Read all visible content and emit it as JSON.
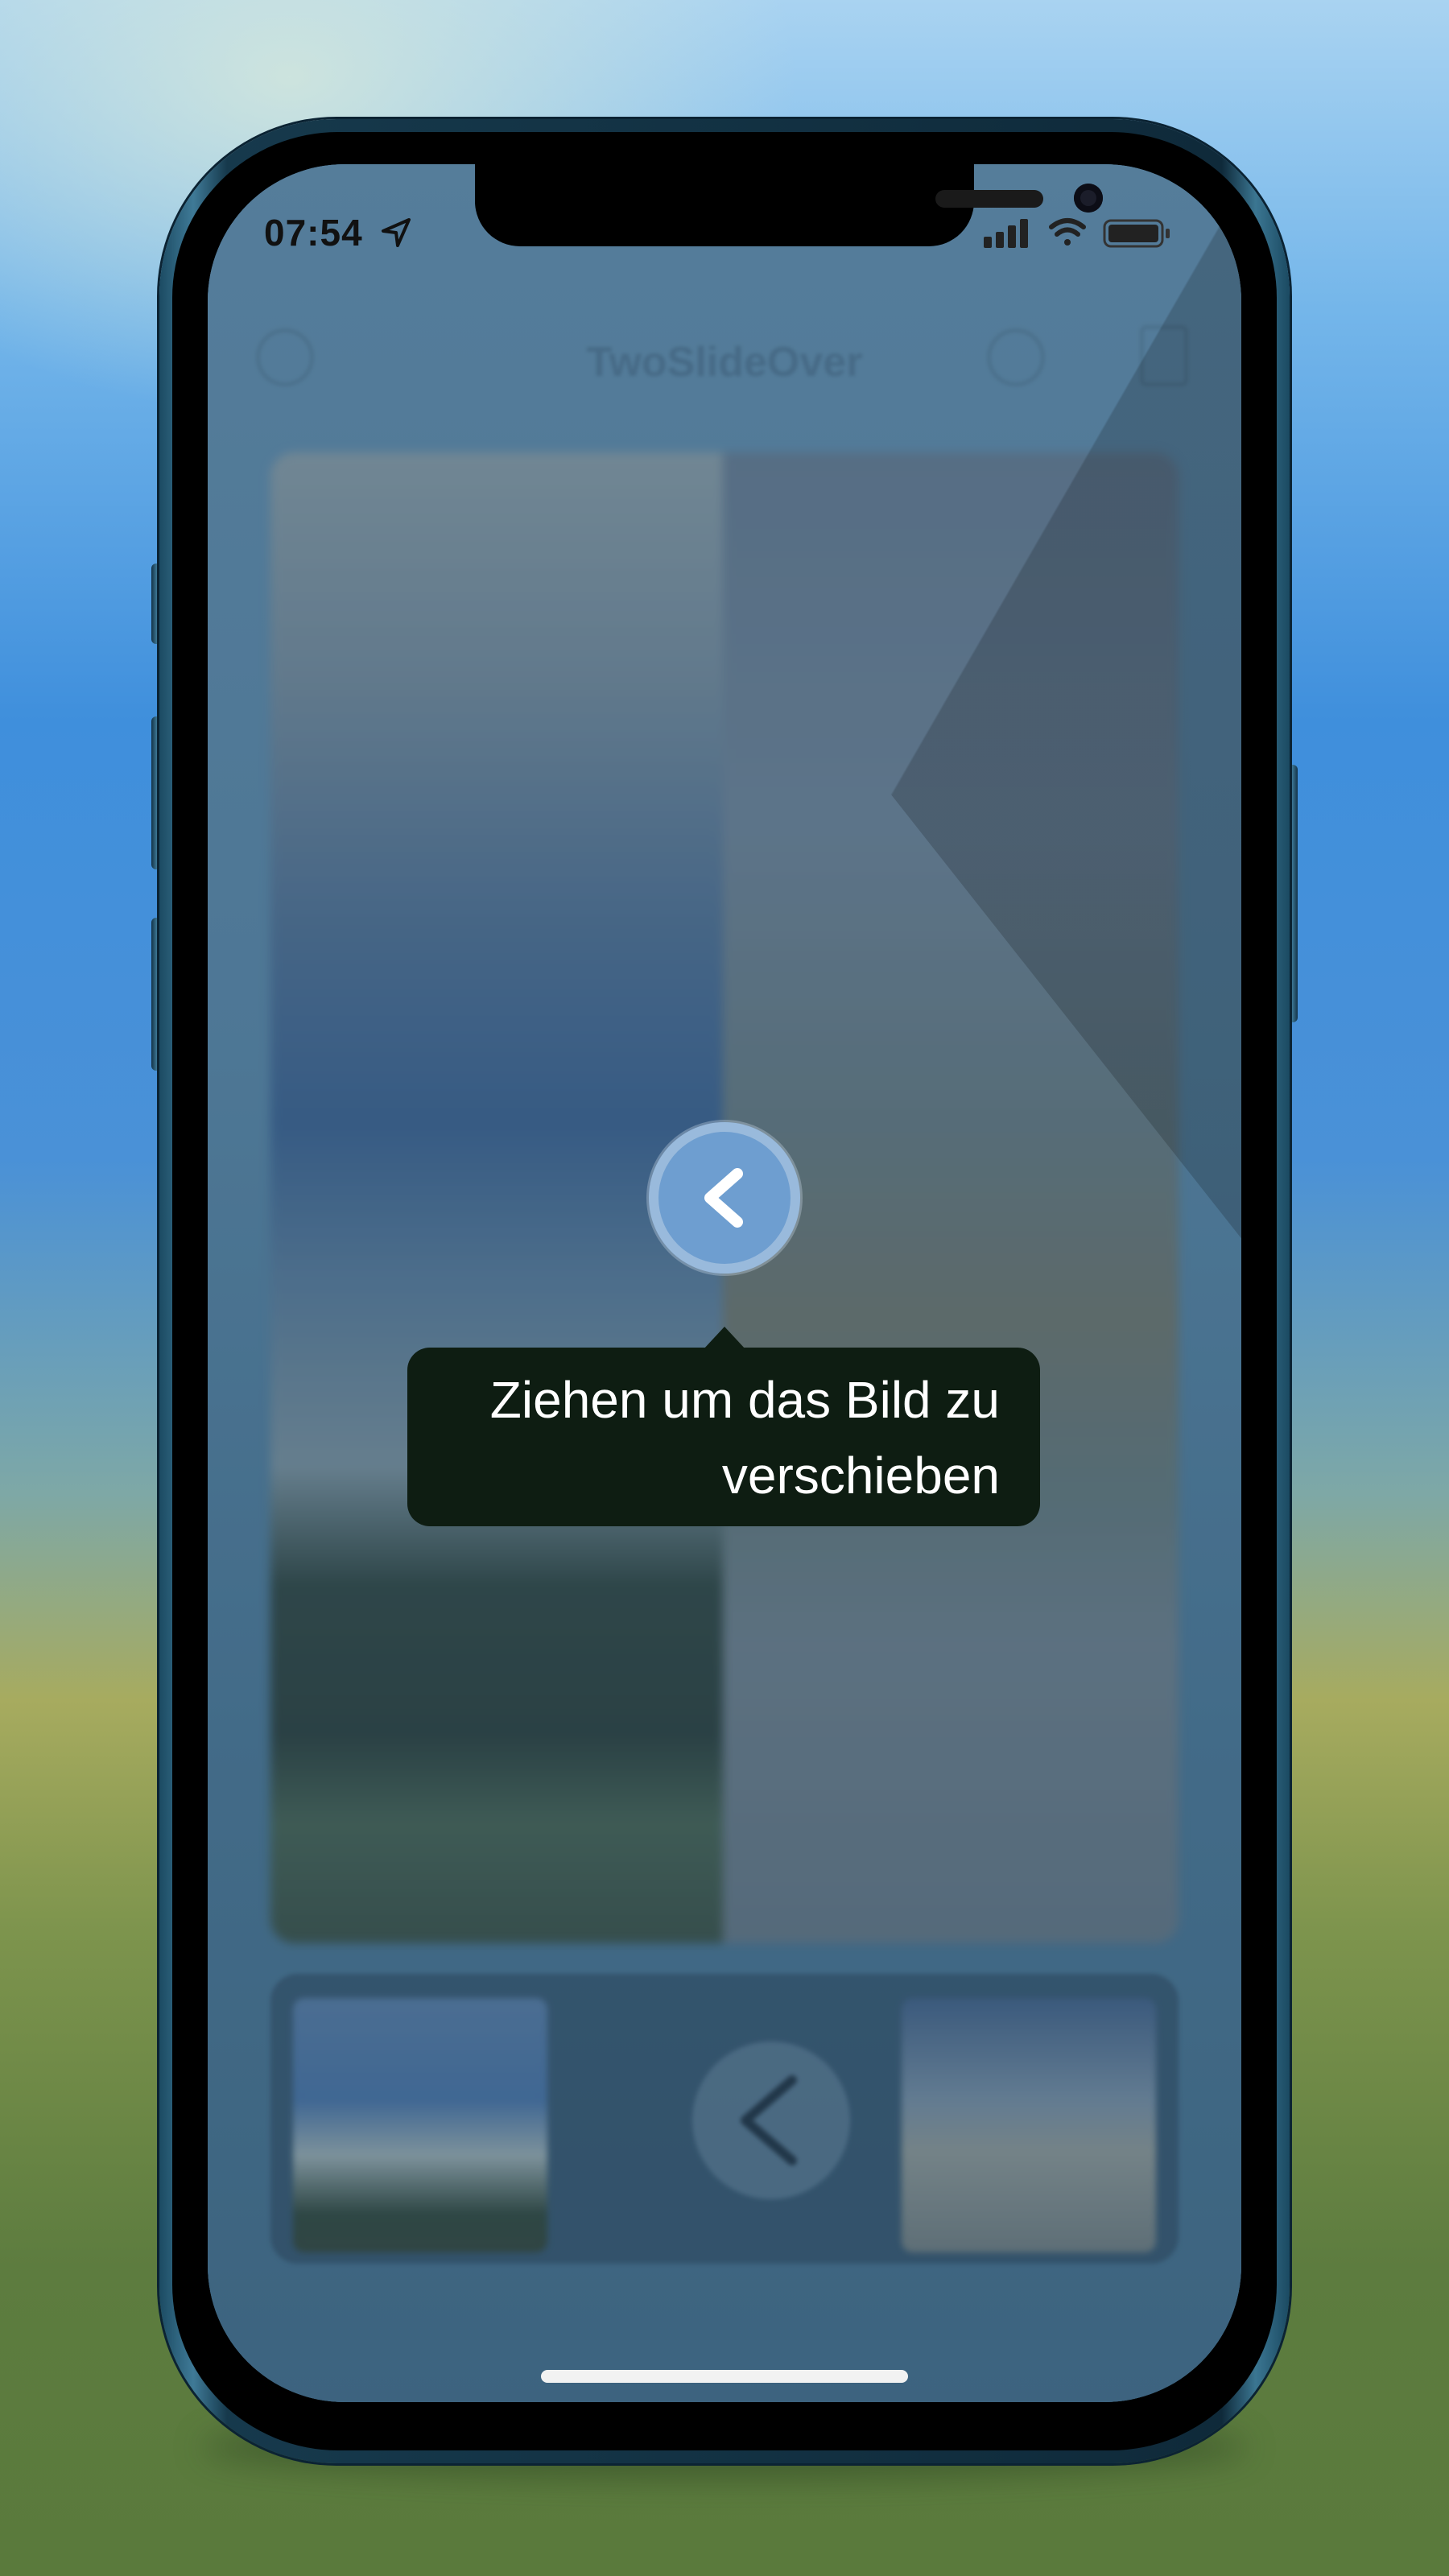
{
  "status_bar": {
    "time": "07:54",
    "icons": [
      "location-arrow-icon",
      "cellular-signal-icon",
      "wifi-icon",
      "battery-icon"
    ]
  },
  "nav": {
    "title": "TwoSlideOver",
    "left_icon": "info-icon",
    "right_icons": [
      "play-icon",
      "share-icon"
    ]
  },
  "comparison": {
    "handle_icon": "chevron-left-icon"
  },
  "thumbnail_strip": {
    "center_button_icon": "chevron-left-icon"
  },
  "coach_mark": {
    "text": "Ziehen um das Bild zu verschieben"
  },
  "colors": {
    "tooltip_background": "#0e1d12",
    "handle_accent": "#6e9ed0",
    "tooltip_text": "#ffffff"
  }
}
